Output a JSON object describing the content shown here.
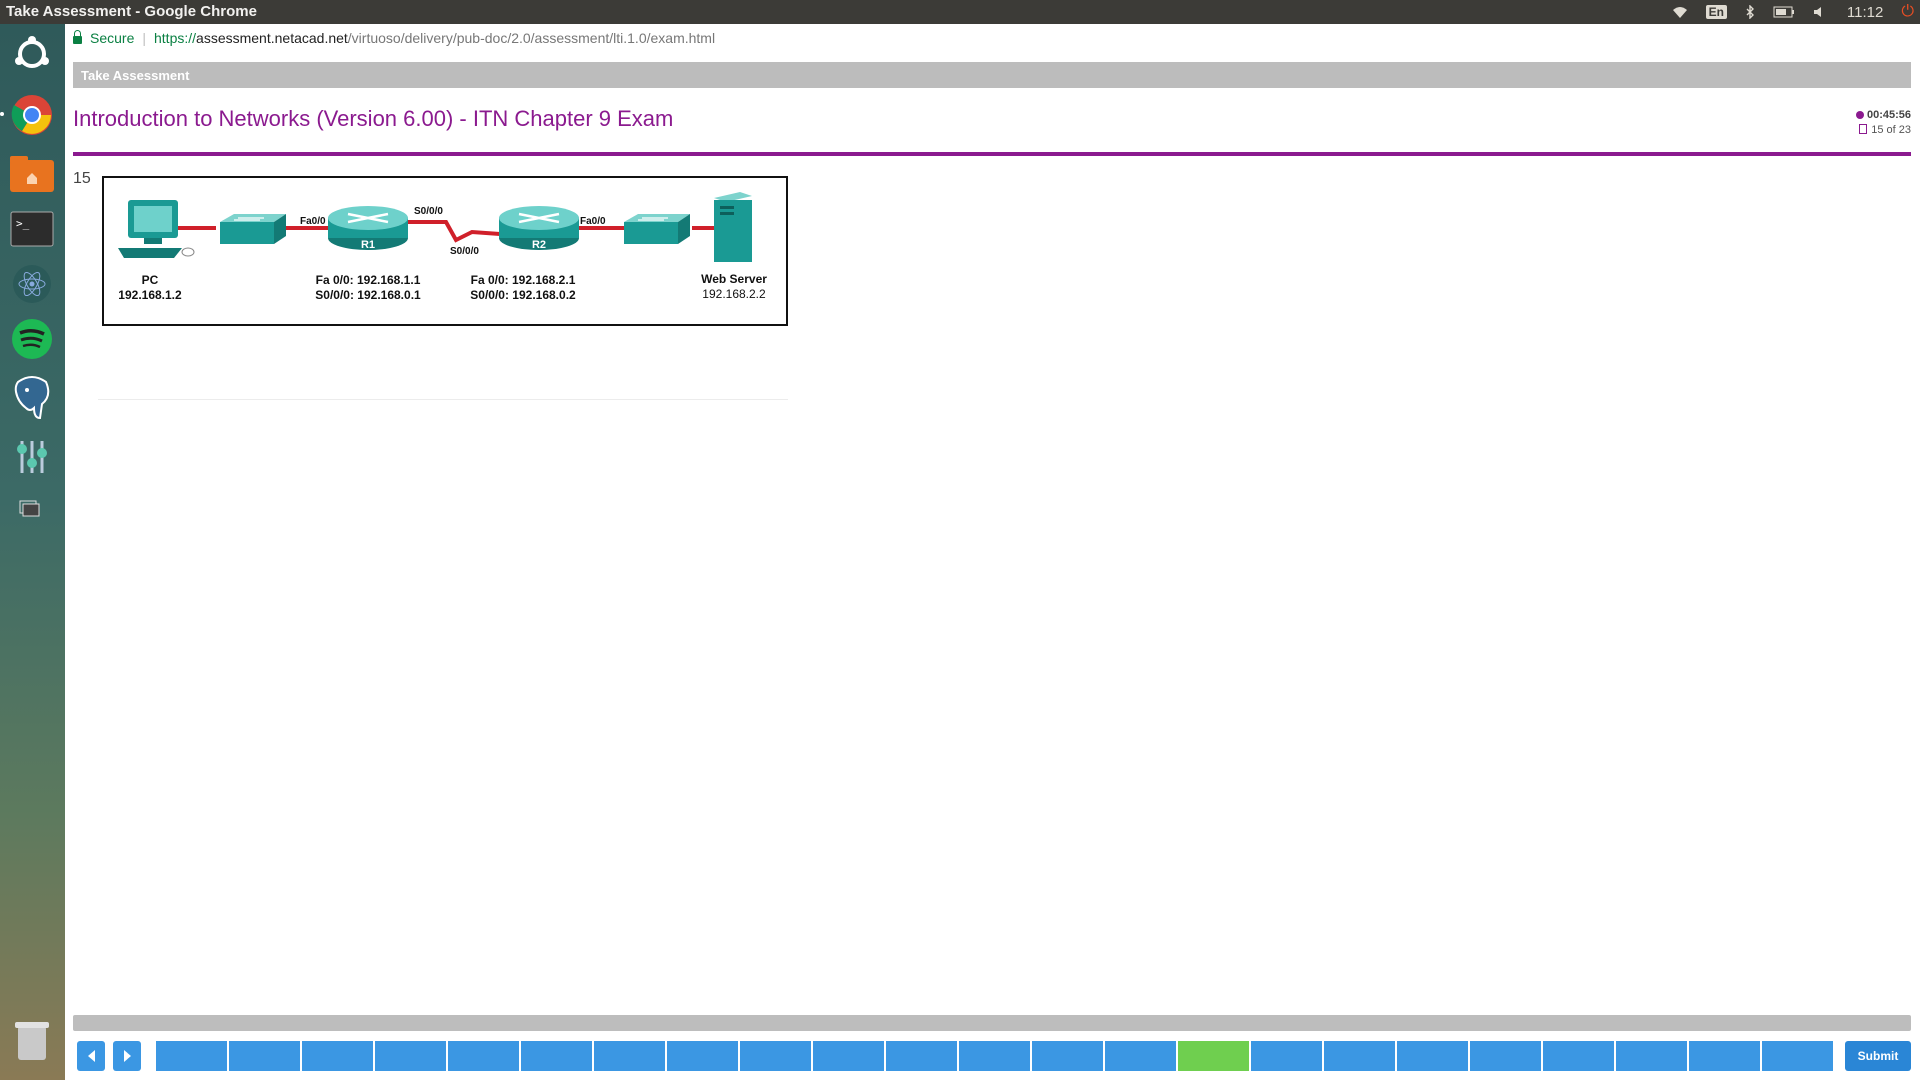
{
  "window": {
    "title": "Take Assessment - Google Chrome",
    "language": "En",
    "time": "11:12"
  },
  "addressbar": {
    "secure_label": "Secure",
    "url_scheme": "https://",
    "url_host": "assessment.netacad.net",
    "url_path": "/virtuoso/delivery/pub-doc/2.0/assessment/lti.1.0/exam.html"
  },
  "page": {
    "header": "Take Assessment",
    "exam_title": "Introduction to Networks (Version 6.00) - ITN Chapter 9 Exam",
    "timer": "00:45:56",
    "question_progress": "15 of 23"
  },
  "question": {
    "number": "15"
  },
  "diagram": {
    "pc_label": "PC",
    "pc_ip": "192.168.1.2",
    "r1_label": "R1",
    "r1_fa": "Fa 0/0: 192.168.1.1",
    "r1_s0": "S0/0/0: 192.168.0.1",
    "r2_label": "R2",
    "r2_fa": "Fa 0/0: 192.168.2.1",
    "r2_s0": "S0/0/0: 192.168.0.2",
    "server_label": "Web Server",
    "server_ip": "192.168.2.2",
    "port_fa_left": "Fa0/0",
    "port_s_top": "S0/0/0",
    "port_s_bottom": "S0/0/0",
    "port_fa_right": "Fa0/0"
  },
  "nav": {
    "total_questions": 23,
    "current_question": 15,
    "submit_label": "Submit",
    "prev_icon": "chevron-left-icon",
    "next_icon": "chevron-right-icon"
  },
  "colors": {
    "accent": "#8b1a8f",
    "nav_blue": "#3b97e3",
    "current_green": "#6fcf4f",
    "device_teal": "#1a9a94",
    "link_red": "#d0202a"
  },
  "launcher_icons": [
    "ubuntu-icon",
    "chrome-icon",
    "files-icon",
    "terminal-icon",
    "atom-icon",
    "spotify-icon",
    "postgres-icon",
    "settings-icon",
    "workspace-icon",
    "trash-icon"
  ]
}
